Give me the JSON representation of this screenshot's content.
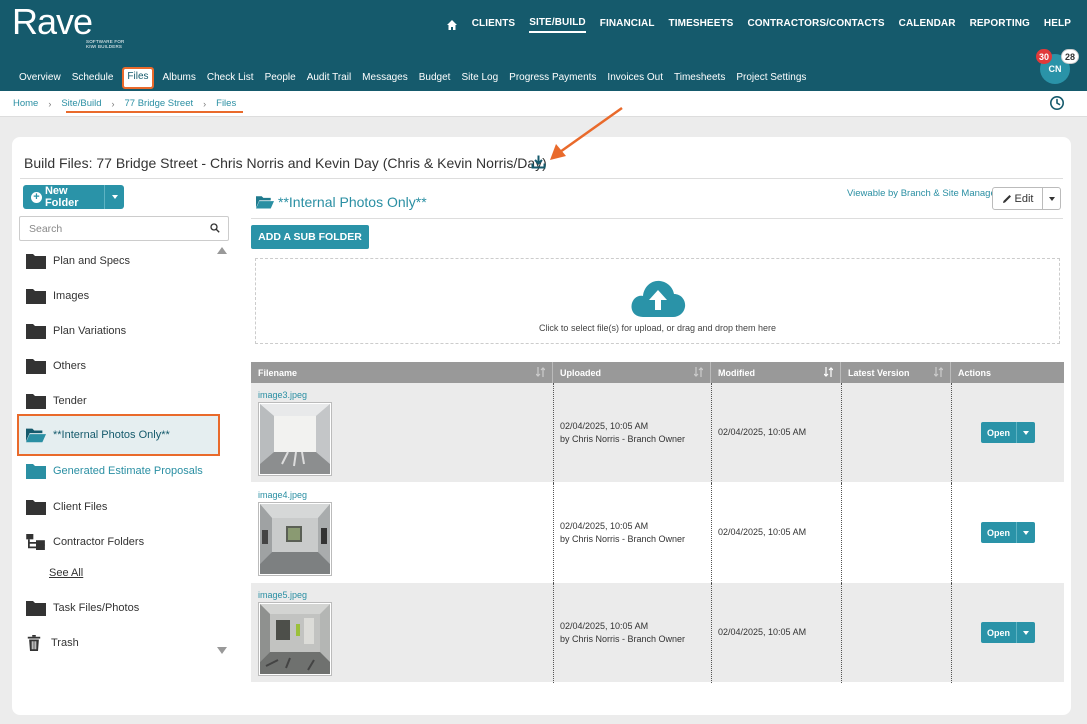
{
  "brand": {
    "name": "Rave",
    "tagline": "SOFTWARE FOR KIWI BUILDERS"
  },
  "topnav": [
    {
      "label": "CLIENTS",
      "active": false
    },
    {
      "label": "SITE/BUILD",
      "active": true
    },
    {
      "label": "FINANCIAL",
      "active": false
    },
    {
      "label": "TIMESHEETS",
      "active": false
    },
    {
      "label": "CONTRACTORS/CONTACTS",
      "active": false
    },
    {
      "label": "CALENDAR",
      "active": false
    },
    {
      "label": "REPORTING",
      "active": false
    },
    {
      "label": "HELP",
      "active": false
    }
  ],
  "subnav": [
    {
      "label": "Overview"
    },
    {
      "label": "Schedule"
    },
    {
      "label": "Files",
      "active": true
    },
    {
      "label": "Albums"
    },
    {
      "label": "Check List"
    },
    {
      "label": "People"
    },
    {
      "label": "Audit Trail"
    },
    {
      "label": "Messages"
    },
    {
      "label": "Budget"
    },
    {
      "label": "Site Log"
    },
    {
      "label": "Progress Payments"
    },
    {
      "label": "Invoices Out"
    },
    {
      "label": "Timesheets"
    },
    {
      "label": "Project Settings"
    }
  ],
  "user": {
    "initials": "CN",
    "notifications": "30",
    "messages": "28"
  },
  "breadcrumb": {
    "home": "Home",
    "site_build": "Site/Build",
    "job": "77 Bridge Street",
    "current": "Files"
  },
  "page": {
    "title": "Build Files: 77 Bridge Street - Chris Norris and Kevin Day (Chris & Kevin Norris/Day)"
  },
  "sidebar": {
    "new_folder_label": "New Folder",
    "search_placeholder": "Search",
    "folders": [
      {
        "label": "Plan and Specs",
        "icon": "folder-icon"
      },
      {
        "label": "Images",
        "icon": "folder-icon"
      },
      {
        "label": "Plan Variations",
        "icon": "folder-icon"
      },
      {
        "label": "Others",
        "icon": "folder-icon"
      },
      {
        "label": "Tender",
        "icon": "folder-icon"
      },
      {
        "label": "**Internal Photos Only**",
        "icon": "folder-open-icon",
        "selected": true
      },
      {
        "label": "Generated Estimate Proposals",
        "icon": "folder-teal-icon"
      },
      {
        "label": "Client Files",
        "icon": "folder-icon"
      },
      {
        "label": "Contractor Folders",
        "icon": "folder-tree-icon"
      },
      {
        "label": "See All",
        "icon": ""
      },
      {
        "label": "Task Files/Photos",
        "icon": "folder-icon"
      },
      {
        "label": "Trash",
        "icon": "trash-icon"
      }
    ]
  },
  "folder": {
    "name": "**Internal Photos Only**",
    "visibility": "Viewable by Branch & Site Manager",
    "edit_label": "Edit",
    "add_sub_folder_label": "ADD A SUB FOLDER",
    "dropzone_text": "Click to select file(s) for upload, or drag and drop them here"
  },
  "table": {
    "columns": [
      "Filename",
      "Uploaded",
      "Modified",
      "Latest Version",
      "Actions"
    ],
    "rows": [
      {
        "filename": "image3.jpeg",
        "uploaded_date": "02/04/2025, 10:05 AM",
        "uploaded_by": "by Chris Norris - Branch Owner",
        "modified": "02/04/2025, 10:05 AM",
        "latest_version": "",
        "action": "Open"
      },
      {
        "filename": "image4.jpeg",
        "uploaded_date": "02/04/2025, 10:05 AM",
        "uploaded_by": "by Chris Norris - Branch Owner",
        "modified": "02/04/2025, 10:05 AM",
        "latest_version": "",
        "action": "Open"
      },
      {
        "filename": "image5.jpeg",
        "uploaded_date": "02/04/2025, 10:05 AM",
        "uploaded_by": "by Chris Norris - Branch Owner",
        "modified": "02/04/2025, 10:05 AM",
        "latest_version": "",
        "action": "Open"
      }
    ]
  },
  "colors": {
    "header": "#155a6c",
    "accent": "#2a93a8",
    "highlight": "#e96a2b",
    "badge": "#e03a3a"
  }
}
